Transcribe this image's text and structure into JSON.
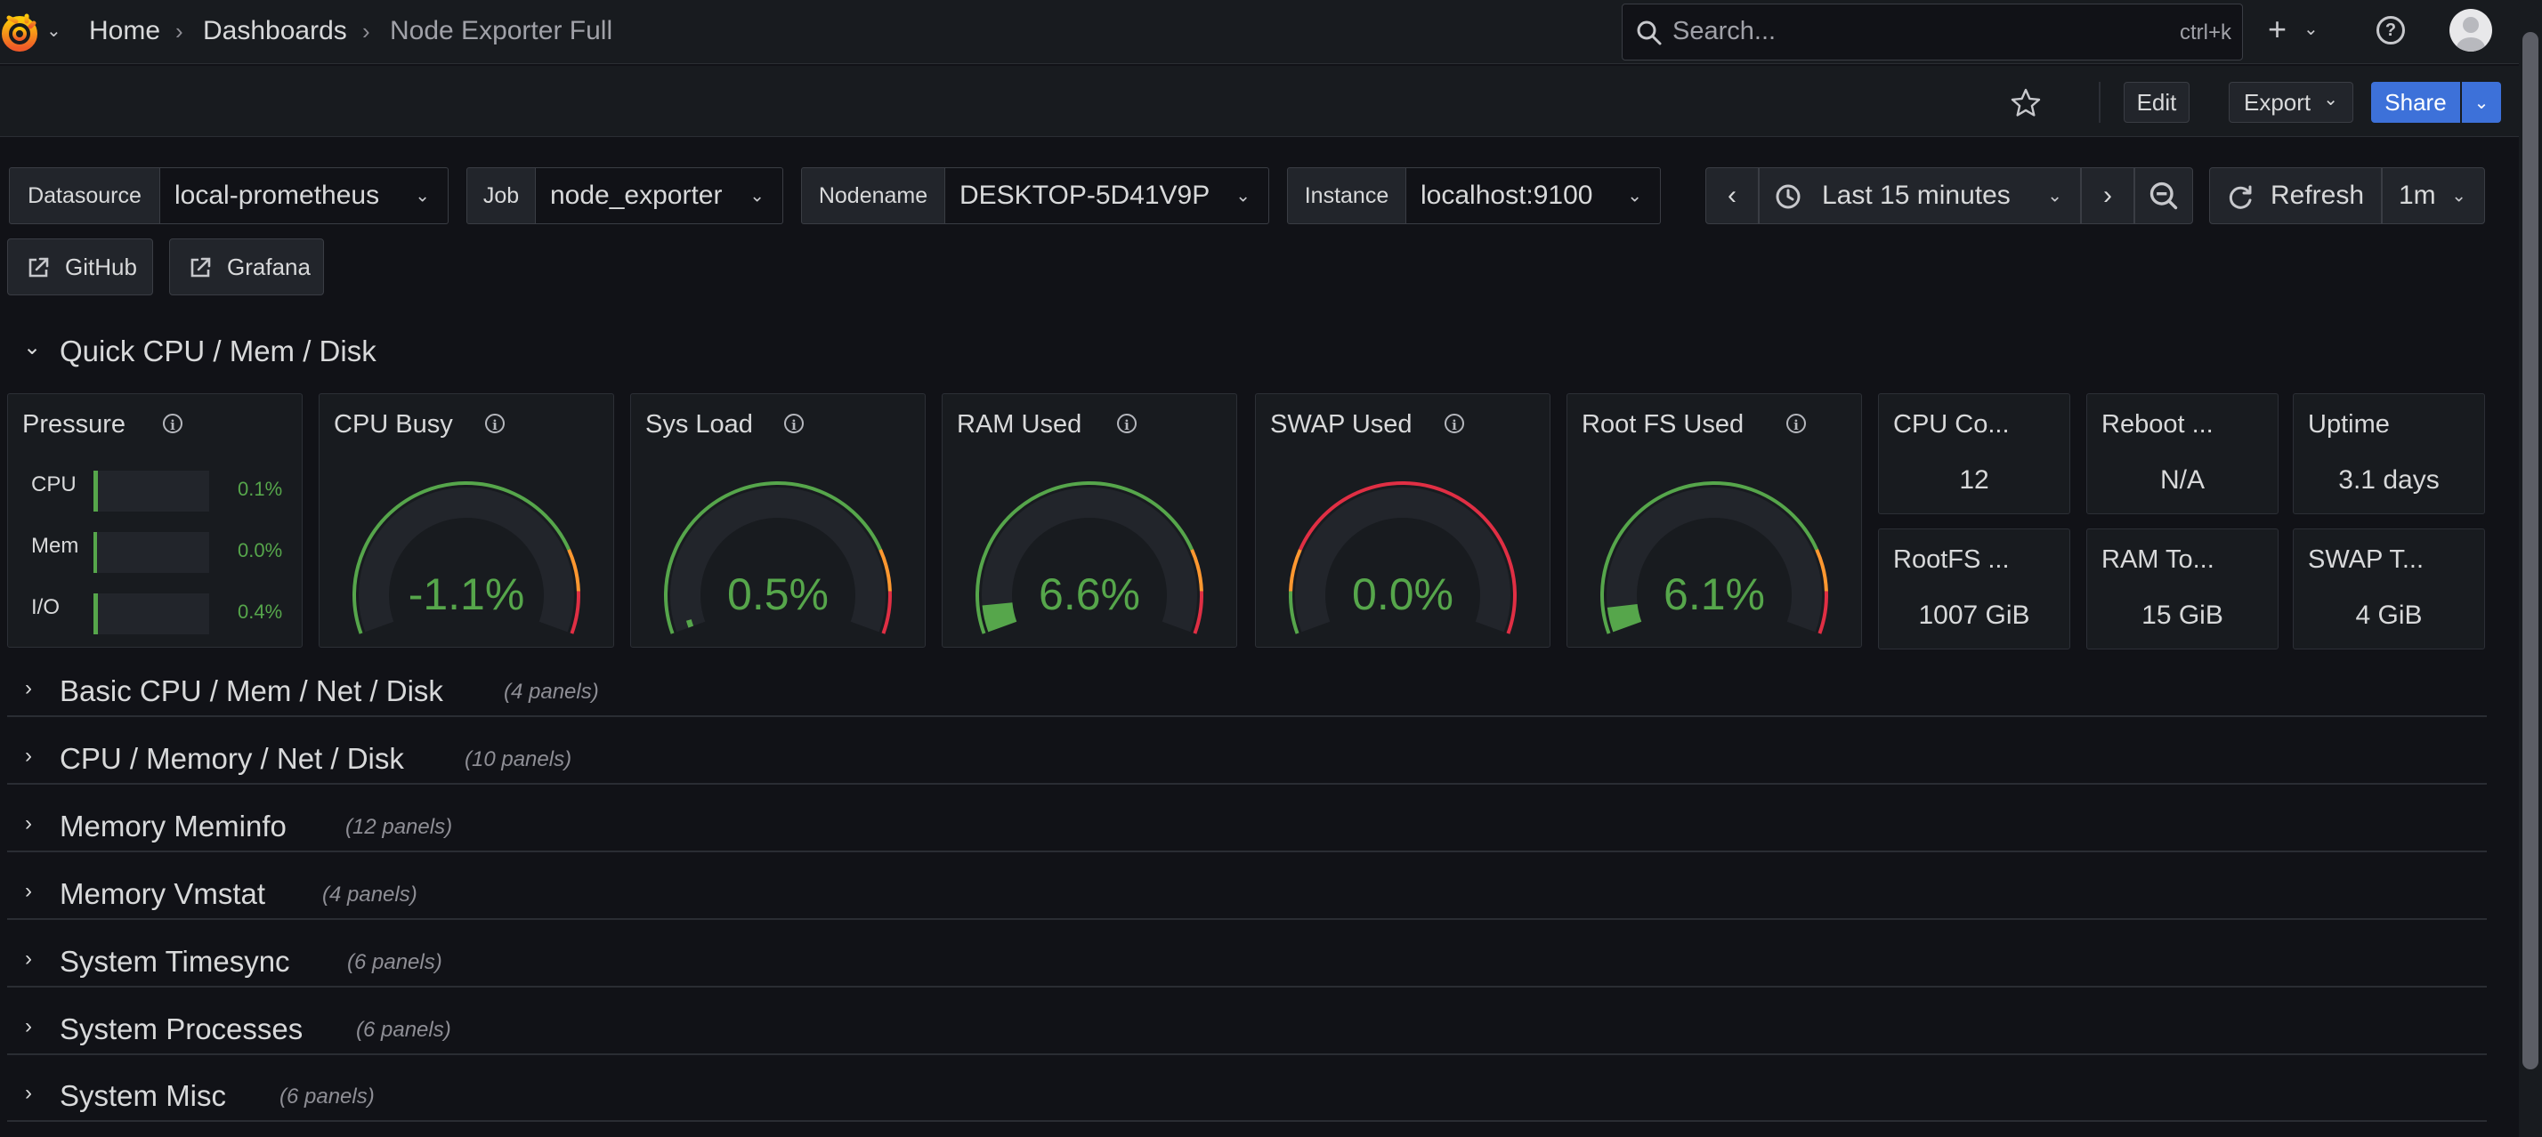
{
  "breadcrumb": {
    "home": "Home",
    "dashboards": "Dashboards",
    "current": "Node Exporter Full"
  },
  "search": {
    "placeholder": "Search...",
    "shortcut": "ctrl+k"
  },
  "toolbar": {
    "edit": "Edit",
    "export": "Export",
    "share": "Share"
  },
  "variables": {
    "datasource": {
      "label": "Datasource",
      "value": "local-prometheus"
    },
    "job": {
      "label": "Job",
      "value": "node_exporter"
    },
    "nodename": {
      "label": "Nodename",
      "value": "DESKTOP-5D41V9P"
    },
    "instance": {
      "label": "Instance",
      "value": "localhost:9100"
    }
  },
  "time": {
    "range": "Last 15 minutes",
    "refresh": "Refresh",
    "interval": "1m"
  },
  "links": {
    "github": "GitHub",
    "grafana": "Grafana"
  },
  "quick_row": {
    "title": "Quick CPU / Mem / Disk"
  },
  "pressure": {
    "title": "Pressure",
    "items": [
      {
        "label": "CPU",
        "value": "0.1%",
        "level": 0.001
      },
      {
        "label": "Mem",
        "value": "0.0%",
        "level": 0.0
      },
      {
        "label": "I/O",
        "value": "0.4%",
        "level": 0.004
      }
    ]
  },
  "gauges": [
    {
      "title": "CPU Busy",
      "value": "-1.1%",
      "fraction": 0.0,
      "scheme": "green-orange-red"
    },
    {
      "title": "Sys Load",
      "value": "0.5%",
      "fraction": 0.005,
      "scheme": "green-orange-red"
    },
    {
      "title": "RAM Used",
      "value": "6.6%",
      "fraction": 0.066,
      "scheme": "green-orange-red"
    },
    {
      "title": "SWAP Used",
      "value": "0.0%",
      "fraction": 0.0,
      "scheme": "red-orange-green"
    },
    {
      "title": "Root FS Used",
      "value": "6.1%",
      "fraction": 0.061,
      "scheme": "green-orange-red"
    }
  ],
  "stats": [
    {
      "title": "CPU Co...",
      "value": "12"
    },
    {
      "title": "Reboot ...",
      "value": "N/A"
    },
    {
      "title": "Uptime",
      "value": "3.1 days"
    },
    {
      "title": "RootFS ...",
      "value": "1007 GiB"
    },
    {
      "title": "RAM To...",
      "value": "15 GiB"
    },
    {
      "title": "SWAP T...",
      "value": "4 GiB"
    }
  ],
  "rows": [
    {
      "title": "Basic CPU / Mem / Net / Disk",
      "count": "(4 panels)"
    },
    {
      "title": "CPU / Memory / Net / Disk",
      "count": "(10 panels)"
    },
    {
      "title": "Memory Meminfo",
      "count": "(12 panels)"
    },
    {
      "title": "Memory Vmstat",
      "count": "(4 panels)"
    },
    {
      "title": "System Timesync",
      "count": "(6 panels)"
    },
    {
      "title": "System Processes",
      "count": "(6 panels)"
    },
    {
      "title": "System Misc",
      "count": "(6 panels)"
    }
  ],
  "colors": {
    "green": "#56a64b",
    "orange": "#ff9830",
    "red": "#e02f44",
    "blue": "#3d71d9"
  }
}
